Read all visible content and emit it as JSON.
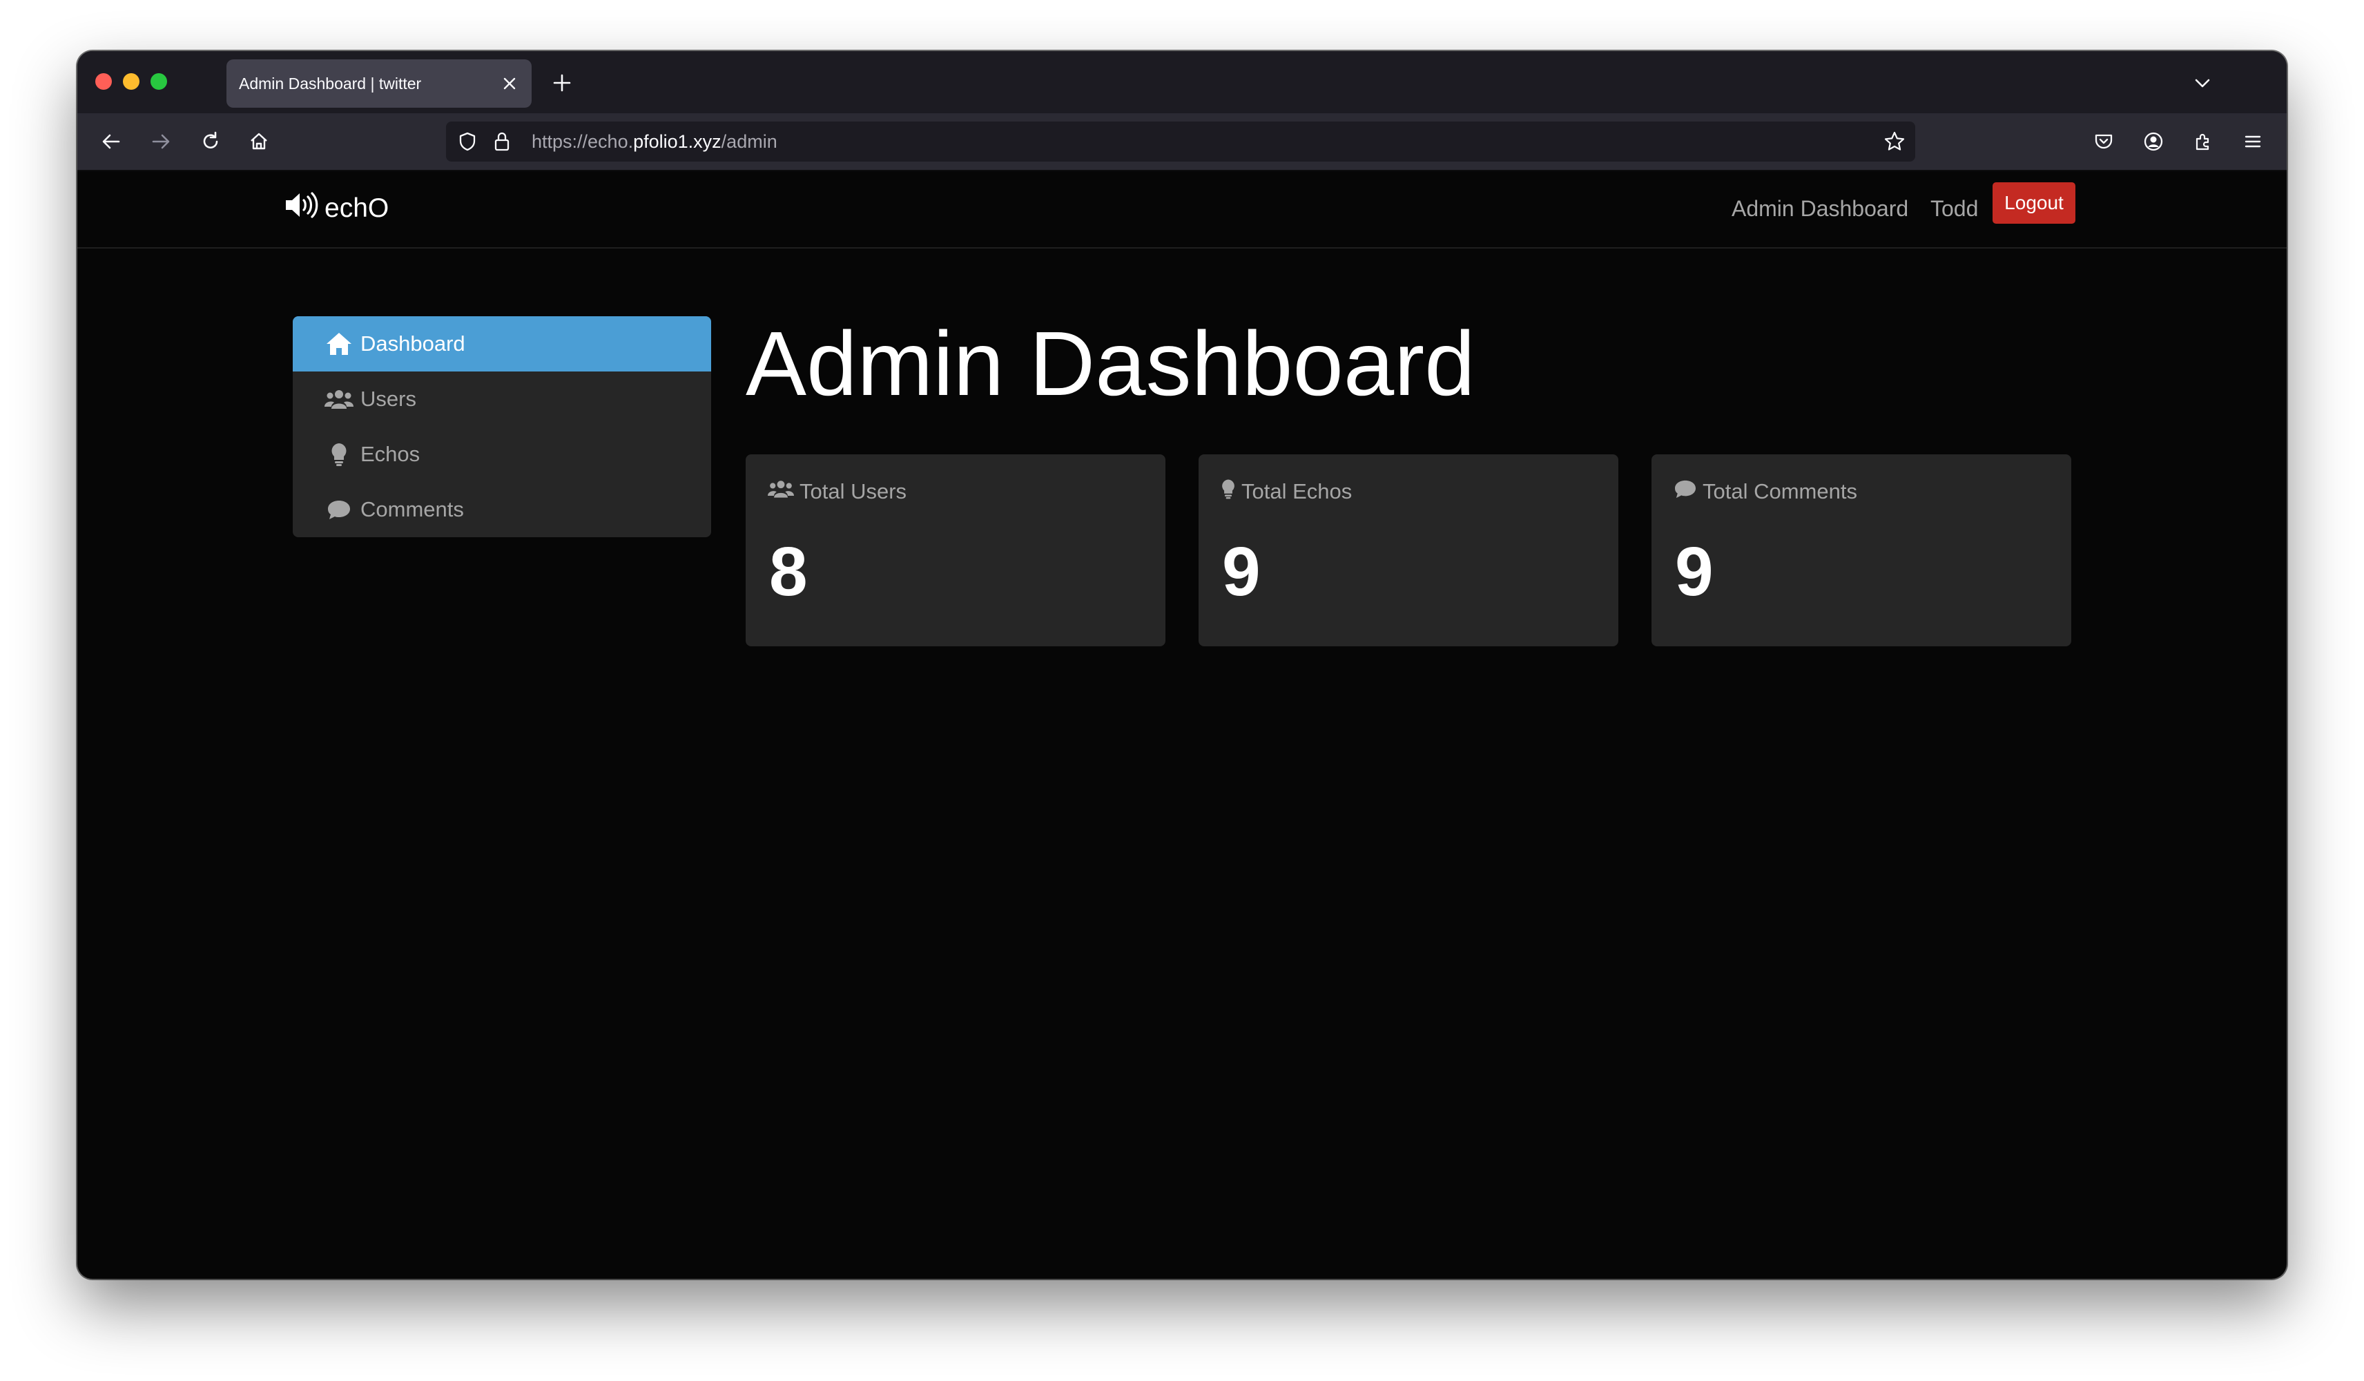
{
  "browser": {
    "tab_title": "Admin Dashboard | twitter",
    "url_prefix": "https://echo.",
    "url_host": "pfolio1.xyz",
    "url_path": "/admin"
  },
  "header": {
    "brand": "echO",
    "admin_link": "Admin Dashboard",
    "user_name": "Todd",
    "logout_label": "Logout"
  },
  "sidebar": {
    "items": [
      {
        "label": "Dashboard",
        "icon": "home-icon",
        "active": true
      },
      {
        "label": "Users",
        "icon": "users-icon",
        "active": false
      },
      {
        "label": "Echos",
        "icon": "lightbulb-icon",
        "active": false
      },
      {
        "label": "Comments",
        "icon": "comment-icon",
        "active": false
      }
    ]
  },
  "main": {
    "title": "Admin Dashboard",
    "cards": [
      {
        "label": "Total Users",
        "value": "8",
        "icon": "users-icon"
      },
      {
        "label": "Total Echos",
        "value": "9",
        "icon": "lightbulb-icon"
      },
      {
        "label": "Total Comments",
        "value": "9",
        "icon": "comment-icon"
      }
    ]
  },
  "colors": {
    "page_bg": "#060606",
    "card_bg": "#262626",
    "active_item": "#4b9ed5",
    "logout_bg": "#c42a22"
  }
}
